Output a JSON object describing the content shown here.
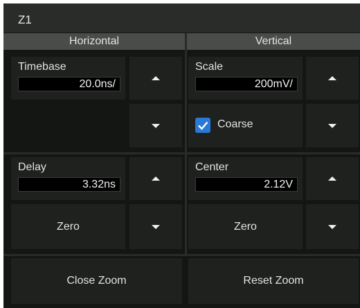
{
  "title": "Z1",
  "horizontal": {
    "heading": "Horizontal",
    "timebase_label": "Timebase",
    "timebase_value": "20.0ns/",
    "delay_label": "Delay",
    "delay_value": "3.32ns",
    "zero_label": "Zero"
  },
  "vertical": {
    "heading": "Vertical",
    "scale_label": "Scale",
    "scale_value": "200mV/",
    "coarse_label": "Coarse",
    "center_label": "Center",
    "center_value": "2.12V",
    "zero_label": "Zero"
  },
  "footer": {
    "close_zoom": "Close Zoom",
    "reset_zoom": "Reset Zoom"
  },
  "coarse_checked": true,
  "accent_color": "#2b79d6",
  "icons": [
    "up-arrow-icon",
    "down-arrow-icon",
    "checkmark-icon"
  ]
}
